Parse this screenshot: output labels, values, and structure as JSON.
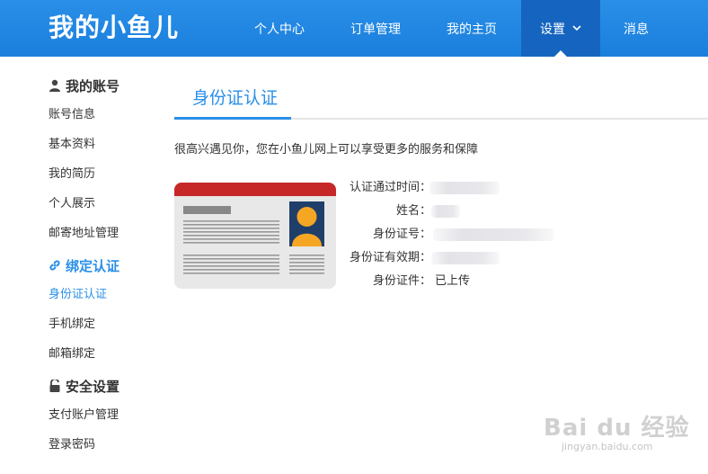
{
  "header": {
    "logo": "我的小鱼儿",
    "nav": [
      {
        "label": "个人中心"
      },
      {
        "label": "订单管理"
      },
      {
        "label": "我的主页"
      },
      {
        "label": "设置",
        "active": true
      },
      {
        "label": "消息"
      }
    ],
    "colors": {
      "bar": "#1e88e5",
      "active": "#1565c0"
    }
  },
  "sidebar": {
    "groups": [
      {
        "title": "我的账号",
        "icon": "user-icon",
        "items": [
          "账号信息",
          "基本资料",
          "我的简历",
          "个人展示",
          "邮寄地址管理"
        ]
      },
      {
        "title": "绑定认证",
        "icon": "link-icon",
        "items": [
          "身份证认证",
          "手机绑定",
          "邮箱绑定"
        ]
      },
      {
        "title": "安全设置",
        "icon": "lock-icon",
        "items": [
          "支付账户管理",
          "登录密码"
        ]
      }
    ],
    "active_item": "身份证认证"
  },
  "main": {
    "tab_title": "身份证认证",
    "intro": "很高兴遇见你，您在小鱼儿网上可以享受更多的服务和保障",
    "info": [
      {
        "label": "认证通过时间：",
        "value": ""
      },
      {
        "label": "姓名：",
        "value": ""
      },
      {
        "label": "身份证号：",
        "value": ""
      },
      {
        "label": "身份证有效期：",
        "value": ""
      },
      {
        "label": "身份证件：",
        "value": "已上传"
      }
    ],
    "accent_color": "#2a8fe8"
  },
  "watermark": {
    "main": "Bai du 经验",
    "sub": "jingyan.baidu.com"
  }
}
